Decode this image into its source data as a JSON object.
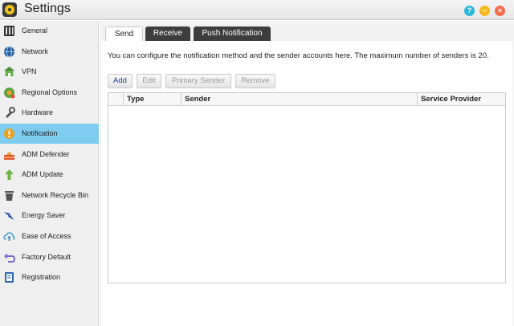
{
  "window": {
    "title": "Settings",
    "app_icon": "settings-gear-icon",
    "buttons": [
      {
        "name": "help",
        "icon": "help-icon",
        "color": "#29b6d8"
      },
      {
        "name": "minimize",
        "icon": "minimize-icon",
        "color": "#f5b921"
      },
      {
        "name": "close",
        "icon": "close-icon",
        "color": "#f36c4d"
      }
    ]
  },
  "sidebar": {
    "active_color": "#7ecdf0",
    "items": [
      {
        "label": "General",
        "icon": "general-icon"
      },
      {
        "label": "Network",
        "icon": "globe-icon"
      },
      {
        "label": "VPN",
        "icon": "vpn-icon"
      },
      {
        "label": "Regional Options",
        "icon": "regional-options-icon"
      },
      {
        "label": "Hardware",
        "icon": "hardware-icon"
      },
      {
        "label": "Notification",
        "icon": "notification-icon",
        "active": true
      },
      {
        "label": "ADM Defender",
        "icon": "defender-icon"
      },
      {
        "label": "ADM Update",
        "icon": "update-arrow-icon"
      },
      {
        "label": "Network Recycle Bin",
        "icon": "recycle-bin-icon"
      },
      {
        "label": "Energy Saver",
        "icon": "energy-saver-icon"
      },
      {
        "label": "Ease of Access",
        "icon": "cloud-upload-icon"
      },
      {
        "label": "Factory Default",
        "icon": "undo-icon"
      },
      {
        "label": "Registration",
        "icon": "registration-icon"
      }
    ]
  },
  "tabs": [
    {
      "label": "Send",
      "active": true
    },
    {
      "label": "Receive",
      "active": false
    },
    {
      "label": "Push Notification",
      "active": false
    }
  ],
  "main": {
    "description": "You can configure the notification method and the sender accounts here. The maximum number of senders is 20.",
    "buttons": [
      {
        "label": "Add",
        "enabled": true
      },
      {
        "label": "Edit",
        "enabled": false
      },
      {
        "label": "Primary Sender",
        "enabled": false
      },
      {
        "label": "Remove",
        "enabled": false
      }
    ],
    "table": {
      "columns": [
        "",
        "Type",
        "Sender",
        "Service Provider"
      ],
      "rows": []
    }
  }
}
